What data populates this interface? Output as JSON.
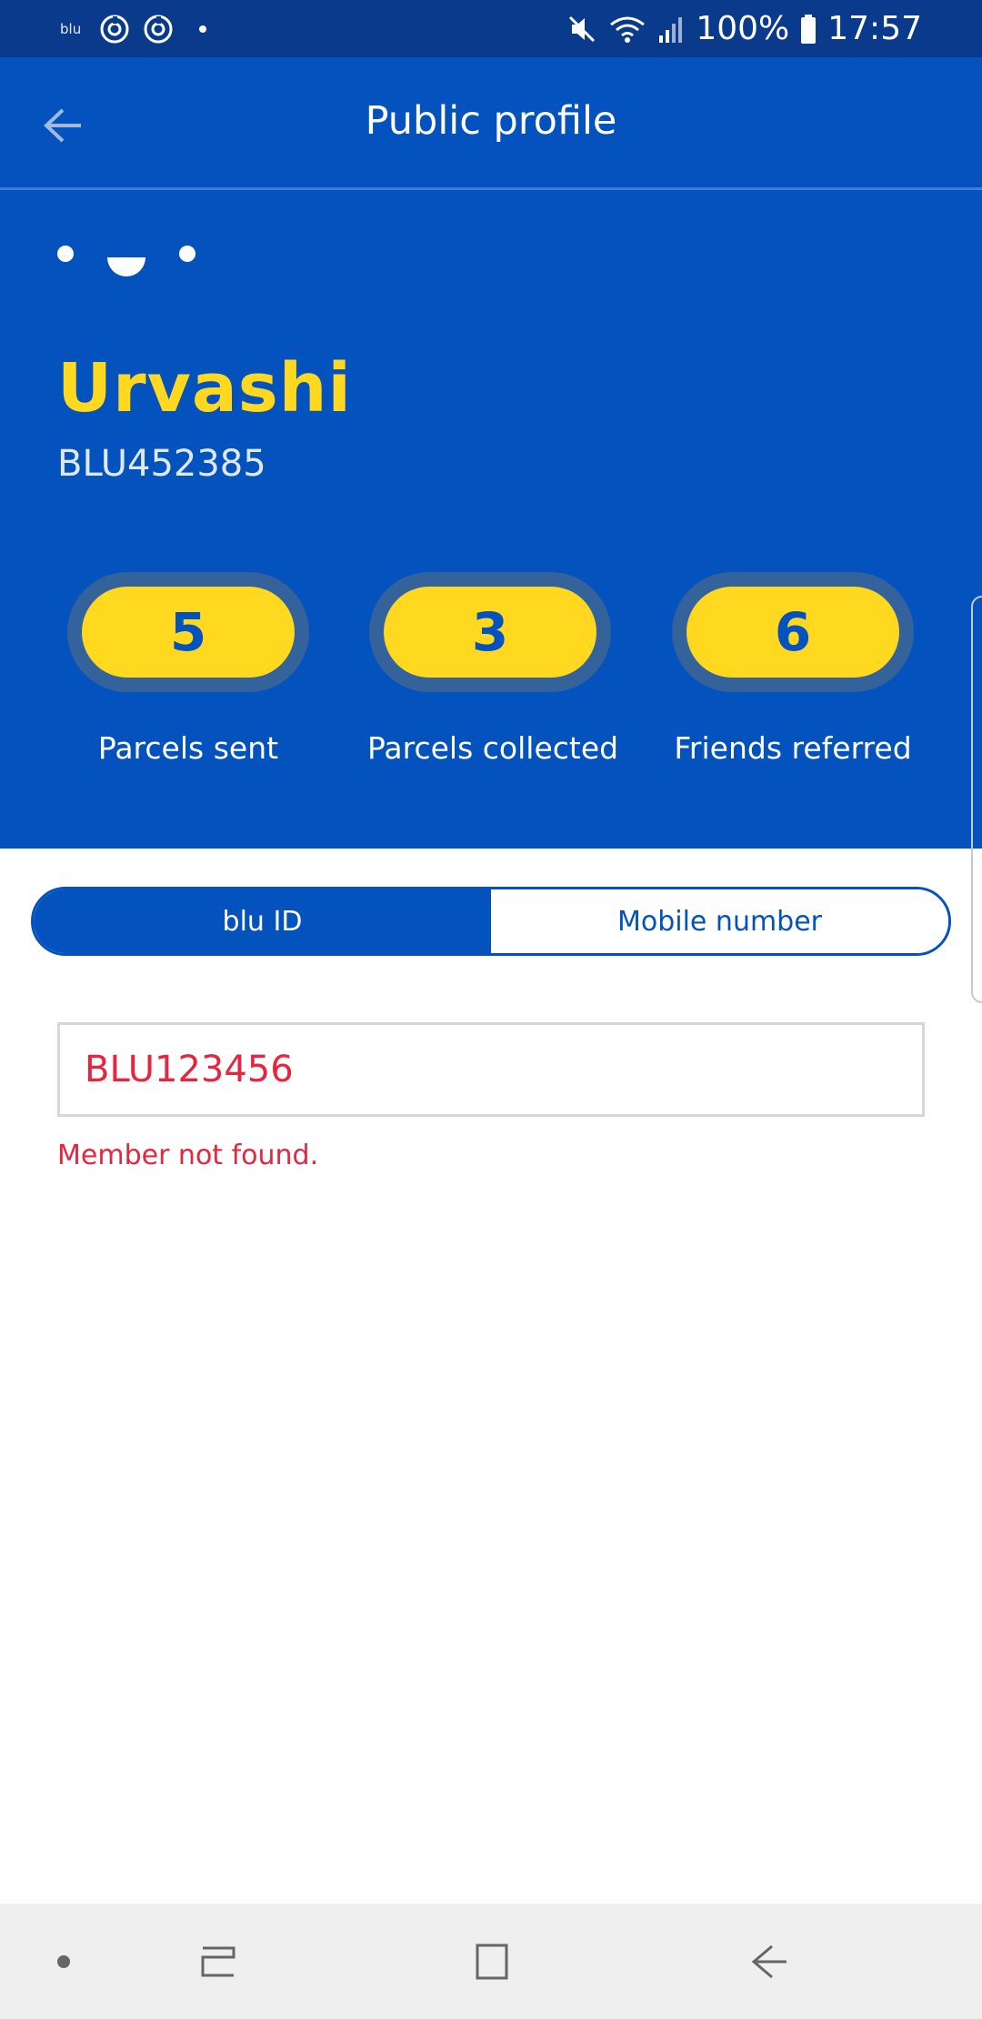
{
  "status_bar": {
    "app_label": "blu",
    "battery": "100%",
    "time": "17:57",
    "icons": [
      "refresh-ring-icon",
      "refresh-ring-icon",
      "dot-icon",
      "mute-icon",
      "wifi-icon",
      "signal-icon",
      "battery-icon"
    ]
  },
  "header": {
    "title": "Public profile",
    "back_icon": "arrow-left-icon"
  },
  "profile": {
    "name": "Urvashi",
    "member_id": "BLU452385",
    "stats": [
      {
        "value": "5",
        "label": "Parcels sent"
      },
      {
        "value": "3",
        "label": "Parcels collected"
      },
      {
        "value": "6",
        "label": "Friends referred"
      }
    ]
  },
  "segment": {
    "options": [
      "blu ID",
      "Mobile number"
    ],
    "selected": "blu ID"
  },
  "search": {
    "value": "BLU123456",
    "error": "Member not found."
  },
  "colors": {
    "brand_blue": "#0352bd",
    "brand_yellow": "#ffd81f",
    "error_red": "#e8253e"
  },
  "nav_bar": {
    "icons": [
      "dot-icon",
      "recent-apps-icon",
      "home-icon",
      "back-icon"
    ]
  }
}
